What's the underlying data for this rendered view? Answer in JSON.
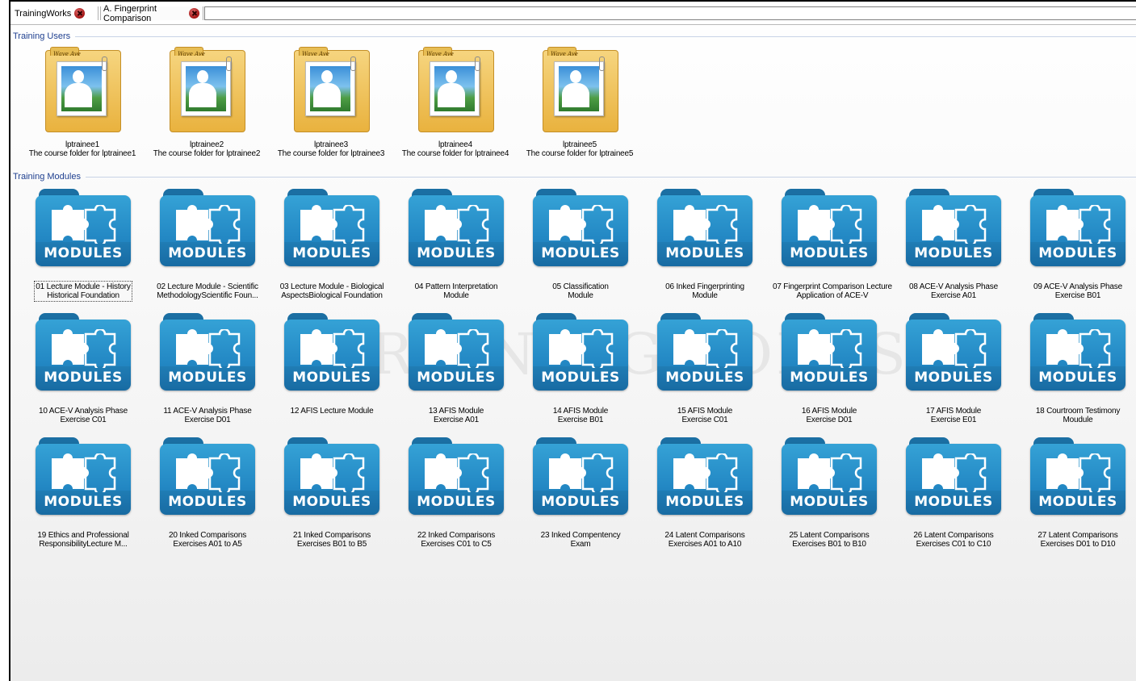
{
  "tabs": [
    {
      "label": "TrainingWorks"
    },
    {
      "label": "A. Fingerprint Comparison"
    }
  ],
  "watermark": "TRAININGWORKS",
  "users_group": {
    "title": "Training Users",
    "folder_caption": "Wave Ave",
    "items": [
      {
        "name": "lptrainee1",
        "desc": "The course folder for lptrainee1"
      },
      {
        "name": "lptrainee2",
        "desc": "The course folder for lptrainee2"
      },
      {
        "name": "lptrainee3",
        "desc": "The course folder for lptrainee3"
      },
      {
        "name": "lptrainee4",
        "desc": "The course folder for lptrainee4"
      },
      {
        "name": "lptrainee5",
        "desc": "The course folder for lptrainee5"
      }
    ]
  },
  "modules_group": {
    "title": "Training Modules",
    "icon_text": "MODULES",
    "items": [
      {
        "line1": "01 Lecture Module - History",
        "line2": "Historical Foundation"
      },
      {
        "line1": "02 Lecture Module - Scientific",
        "line2": "MethodologyScientific Foun..."
      },
      {
        "line1": "03 Lecture Module - Biological",
        "line2": "AspectsBiological Foundation"
      },
      {
        "line1": "04 Pattern Interpretation",
        "line2": "Module"
      },
      {
        "line1": "05 Classification",
        "line2": "Module"
      },
      {
        "line1": "06 Inked Fingerprinting",
        "line2": "Module"
      },
      {
        "line1": "07 Fingerprint Comparison Lecture",
        "line2": "Application of ACE-V"
      },
      {
        "line1": "08 ACE-V Analysis Phase",
        "line2": "Exercise A01"
      },
      {
        "line1": "09 ACE-V Analysis Phase",
        "line2": "Exercise B01"
      },
      {
        "line1": "10 ACE-V Analysis Phase",
        "line2": "Exercise C01"
      },
      {
        "line1": "11 ACE-V Analysis Phase",
        "line2": "Exercise D01"
      },
      {
        "line1": "12 AFIS Lecture Module",
        "line2": ""
      },
      {
        "line1": "13 AFIS Module",
        "line2": "Exercise A01"
      },
      {
        "line1": "14 AFIS Module",
        "line2": "Exercise B01"
      },
      {
        "line1": "15 AFIS Module",
        "line2": "Exercise C01"
      },
      {
        "line1": "16 AFIS Module",
        "line2": "Exercise D01"
      },
      {
        "line1": "17 AFIS Module",
        "line2": "Exercise E01"
      },
      {
        "line1": "18 Courtroom Testimony",
        "line2": "Moudule"
      },
      {
        "line1": "19 Ethics and Professional",
        "line2": "ResponsibilityLecture M..."
      },
      {
        "line1": "20 Inked Comparisons",
        "line2": "Exercises A01 to A5"
      },
      {
        "line1": "21 Inked Comparisons",
        "line2": "Exercises B01 to B5"
      },
      {
        "line1": "22 Inked Comparisons",
        "line2": "Exercises C01 to C5"
      },
      {
        "line1": "23 Inked Compentency",
        "line2": "Exam"
      },
      {
        "line1": "24 Latent Comparisons",
        "line2": "Exercises A01 to A10"
      },
      {
        "line1": "25 Latent Comparisons",
        "line2": "Exercises B01 to B10"
      },
      {
        "line1": "26 Latent Comparisons",
        "line2": "Exercises C01 to C10"
      },
      {
        "line1": "27 Latent Comparisons",
        "line2": "Exercises D01 to D10"
      }
    ]
  }
}
